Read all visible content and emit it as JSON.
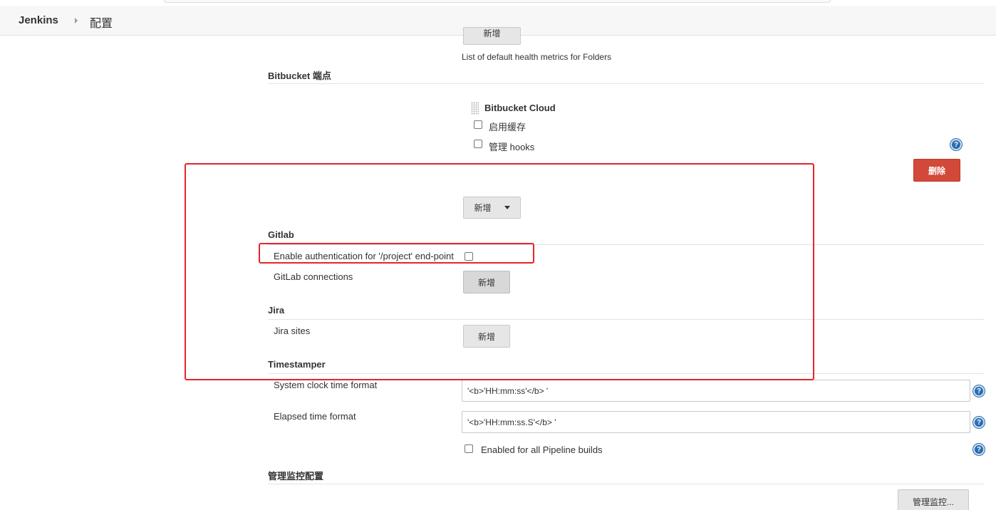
{
  "breadcrumb": {
    "home": "Jenkins",
    "page": "配置"
  },
  "folder_health": {
    "add_label": "新增",
    "description": "List of default health metrics for Folders"
  },
  "bitbucket": {
    "section_title": "Bitbucket 端点",
    "endpoint_name": "Bitbucket Cloud",
    "enable_cache_label": "启用缓存",
    "manage_hooks_label": "管理 hooks",
    "delete_label": "删除",
    "add_label": "新增"
  },
  "gitlab": {
    "section_title": "Gitlab",
    "auth_label": "Enable authentication for '/project' end-point",
    "connections_label": "GitLab connections",
    "add_label": "新增"
  },
  "jira": {
    "section_title": "Jira",
    "sites_label": "Jira sites",
    "add_label": "新增"
  },
  "timestamper": {
    "section_title": "Timestamper",
    "system_clock_label": "System clock time format",
    "system_clock_value": "'<b>'HH:mm:ss'</b> '",
    "elapsed_label": "Elapsed time format",
    "elapsed_value": "'<b>'HH:mm:ss.S'</b> '",
    "pipeline_label": "Enabled for all Pipeline builds"
  },
  "monitoring": {
    "section_title": "管理监控配置",
    "button_label": "管理监控..."
  },
  "help_glyph": "?",
  "colors": {
    "annotation_red": "#e8232b",
    "danger_button": "#d24939",
    "help_blue": "#2a6db0"
  }
}
